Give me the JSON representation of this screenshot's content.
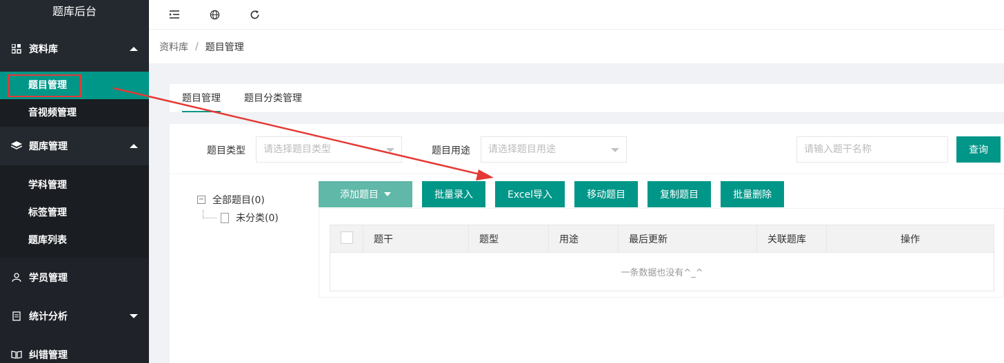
{
  "sidebar": {
    "title": "题库后台",
    "groups": [
      {
        "label": "资料库",
        "icon": "grid-icon",
        "expanded": true,
        "items": [
          {
            "label": "题目管理",
            "active": true
          },
          {
            "label": "音视频管理",
            "active": false
          }
        ]
      },
      {
        "label": "题库管理",
        "icon": "layers-icon",
        "expanded": true,
        "items": [
          {
            "label": "学科管理"
          },
          {
            "label": "标签管理"
          },
          {
            "label": "题库列表"
          }
        ]
      },
      {
        "label": "学员管理",
        "icon": "user-icon"
      },
      {
        "label": "统计分析",
        "icon": "clipboard-icon",
        "expanded": false
      },
      {
        "label": "纠错管理",
        "icon": "book-icon"
      }
    ]
  },
  "topbar": {
    "icons": [
      "menu-collapse-icon",
      "globe-icon",
      "refresh-icon"
    ]
  },
  "breadcrumb": {
    "root": "资料库",
    "sep": "/",
    "current": "题目管理"
  },
  "tabs": [
    {
      "label": "题目管理",
      "active": true
    },
    {
      "label": "题目分类管理",
      "active": false
    }
  ],
  "filters": {
    "type_label": "题目类型",
    "type_placeholder": "请选择题目类型",
    "usage_label": "题目用途",
    "usage_placeholder": "请选择题目用途",
    "search_placeholder": "请输入题干名称",
    "query_label": "查询"
  },
  "tree": {
    "root": "全部题目(0)",
    "children": [
      "未分类(0)"
    ]
  },
  "actions": {
    "add": "添加题目",
    "batch_input": "批量录入",
    "excel_import": "Excel导入",
    "move": "移动题目",
    "copy": "复制题目",
    "batch_delete": "批量删除"
  },
  "table": {
    "headers": [
      "题干",
      "题型",
      "用途",
      "最后更新",
      "关联题库",
      "操作"
    ],
    "empty_text": "一条数据也没有^_^"
  },
  "colors": {
    "accent": "#009688",
    "sidebar": "#1f2329",
    "annotation": "#e53935"
  }
}
